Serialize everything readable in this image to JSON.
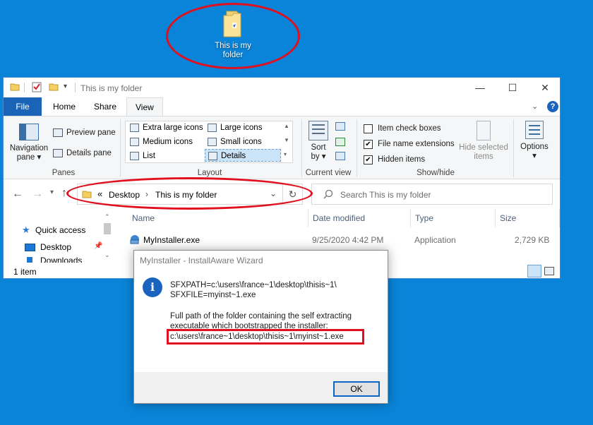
{
  "desktop": {
    "folder_label_line1": "This is my",
    "folder_label_line2": "folder"
  },
  "explorer": {
    "title": "This is my folder",
    "tabs": [
      "File",
      "Home",
      "Share",
      "View"
    ],
    "ribbon": {
      "panes": {
        "navigation_pane_line1": "Navigation",
        "navigation_pane_line2": "pane",
        "preview_pane": "Preview pane",
        "details_pane": "Details pane",
        "group_label": "Panes"
      },
      "layout": {
        "items": [
          "Extra large icons",
          "Large icons",
          "Medium icons",
          "Small icons",
          "List",
          "Details"
        ],
        "selected": "Details",
        "group_label": "Layout"
      },
      "current_view": {
        "sort_by_line1": "Sort",
        "sort_by_line2": "by",
        "group_label": "Current view"
      },
      "show_hide": {
        "item_check_boxes": "Item check boxes",
        "file_name_extensions": "File name extensions",
        "hidden_items": "Hidden items",
        "hide_selected_line1": "Hide selected",
        "hide_selected_line2": "items",
        "group_label": "Show/hide",
        "checked": {
          "item_check_boxes": false,
          "file_name_extensions": true,
          "hidden_items": true
        }
      },
      "options_label": "Options"
    },
    "address": {
      "crumb_overflow": "«",
      "crumb_1": "Desktop",
      "crumb_2": "This is my folder",
      "search_placeholder": "Search This is my folder"
    },
    "nav": {
      "quick_access": "Quick access",
      "desktop": "Desktop",
      "downloads": "Downloads"
    },
    "columns": [
      "Name",
      "Date modified",
      "Type",
      "Size"
    ],
    "files": [
      {
        "name": "MyInstaller.exe",
        "date": "9/25/2020 4:42 PM",
        "type": "Application",
        "size": "2,729 KB"
      }
    ],
    "status": "1 item"
  },
  "dialog": {
    "title": "MyInstaller - InstallAware Wizard",
    "line1": "SFXPATH=c:\\users\\france~1\\desktop\\thisis~1\\",
    "line2": "SFXFILE=myinst~1.exe",
    "line3": "Full path of the folder containing the self extracting",
    "line4": "executable which bootstrapped the installer:",
    "line5": "c:\\users\\france~1\\desktop\\thisis~1\\myinst~1.exe",
    "ok_label": "OK"
  },
  "colors": {
    "desktop_bg": "#0a84d8",
    "accent": "#1a64b8",
    "annotation_red": "#e0101e"
  }
}
